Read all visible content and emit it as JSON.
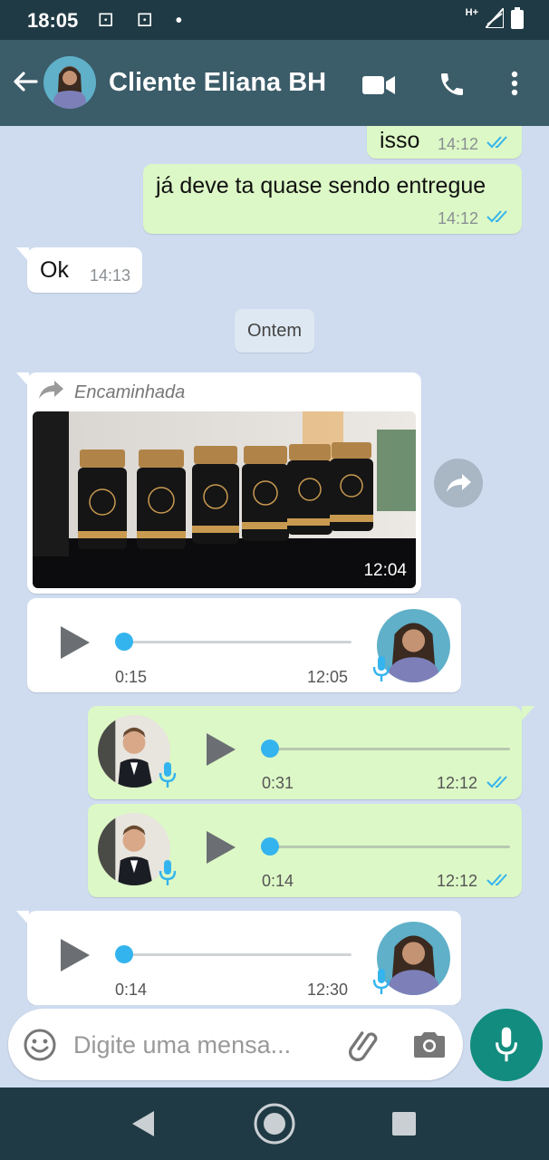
{
  "status_bar": {
    "time": "18:05",
    "left_icons": "⚀ ⚀ •",
    "network": "H+"
  },
  "header": {
    "contact_name": "Cliente Eliana BH"
  },
  "messages": [
    {
      "text": "isso",
      "time": "14:12"
    },
    {
      "text": "já deve ta quase sendo entregue",
      "time": "14:12"
    },
    {
      "text": "Ok",
      "time": "14:13"
    }
  ],
  "date_chip": "Ontem",
  "forwarded": {
    "label": "Encaminhada",
    "time": "12:04"
  },
  "voice_messages": [
    {
      "duration": "0:15",
      "time": "12:05"
    },
    {
      "duration": "0:31",
      "time": "12:12"
    },
    {
      "duration": "0:14",
      "time": "12:12"
    },
    {
      "duration": "0:14",
      "time": "12:30"
    }
  ],
  "input": {
    "placeholder": "Digite uma mensa..."
  },
  "colors": {
    "header": "#3b5c69",
    "outgoing": "#dcf8c6",
    "incoming": "#ffffff",
    "accent": "#128c7e",
    "read_ticks": "#34b4ee"
  },
  "icons": [
    "back-arrow-icon",
    "video-call-icon",
    "phone-icon",
    "more-options-icon",
    "share-forward-icon",
    "emoji-icon",
    "attach-icon",
    "camera-icon",
    "mic-icon",
    "nav-back-icon",
    "nav-home-icon",
    "nav-recents-icon"
  ]
}
